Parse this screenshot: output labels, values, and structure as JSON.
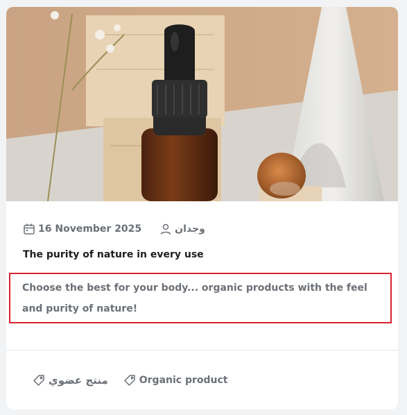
{
  "post": {
    "date": "16 November 2025",
    "author": "وجدان",
    "title": "The purity of nature in every use",
    "excerpt": "Choose the best for your body... organic products with the feel and purity of nature!"
  },
  "tags": [
    {
      "label": "منتج عضوي"
    },
    {
      "label": "Organic product"
    }
  ],
  "icons": {
    "date": "calendar-icon",
    "author": "user-icon",
    "tag": "tag-icon"
  },
  "colors": {
    "highlight": "#d9232f",
    "muted_text": "#6b7076",
    "title_text": "#1c1e21"
  }
}
